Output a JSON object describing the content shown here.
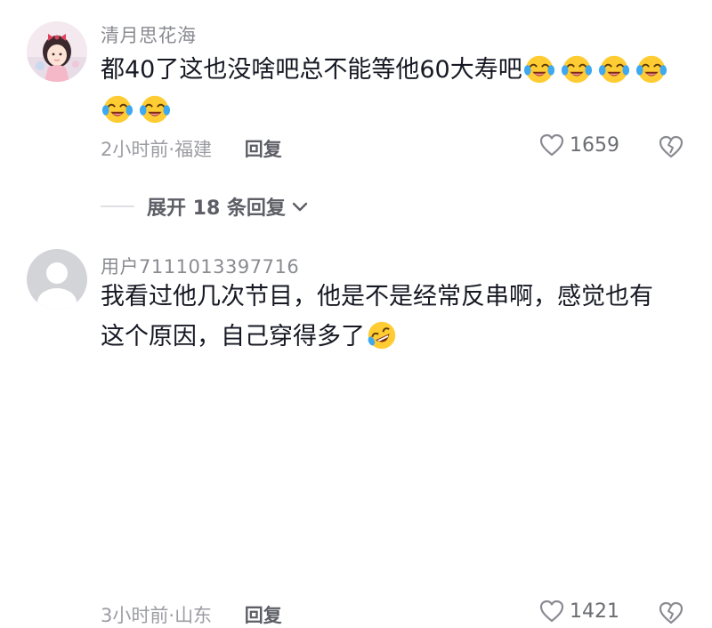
{
  "comments": [
    {
      "username": "清月思花海",
      "avatar": "anime-girl-avatar",
      "line1": "都40了这也没啥吧总不能等他60大寿吧",
      "emojis_line1": [
        "crying-laughing",
        "crying-laughing",
        "crying-laughing",
        "crying-laughing"
      ],
      "emojis_line2": [
        "crying-laughing",
        "crying-laughing"
      ],
      "time": "2小时前",
      "sep": "·",
      "location": "福建",
      "reply_label": "回复",
      "likes": "1659"
    },
    {
      "username": "用户7111013397716",
      "avatar": "default-gray-avatar",
      "line1": "我看过他几次节目，他是不是经常反串啊，感觉也有",
      "line2": "这个原因，自己穿得多了",
      "emojis_line2": [
        "rofl"
      ],
      "time": "3小时前",
      "sep": "·",
      "location": "山东",
      "reply_label": "回复",
      "likes": "1421"
    }
  ],
  "expand_replies": {
    "label": "展开 18 条回复"
  },
  "icons": {
    "like": "heart-outline-icon",
    "dislike": "broken-heart-outline-icon",
    "expand": "chevron-down-icon"
  }
}
